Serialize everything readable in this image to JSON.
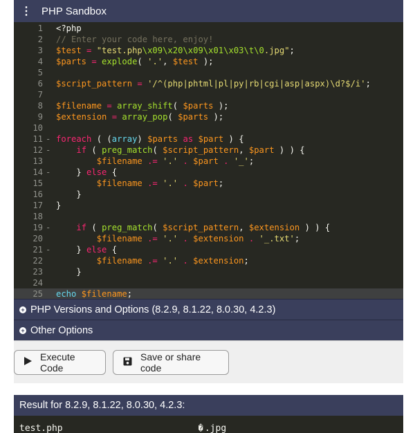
{
  "app": {
    "title": "PHP Sandbox",
    "menu_glyph": "⋮"
  },
  "editor": {
    "line_numbers": [
      "1",
      "2",
      "3",
      "4",
      "5",
      "6",
      "7",
      "8",
      "9",
      "10",
      "11",
      "12",
      "13",
      "14",
      "15",
      "16",
      "17",
      "18",
      "19",
      "20",
      "21",
      "22",
      "23",
      "24",
      "25"
    ],
    "fold_markers": [
      "",
      "",
      "",
      "",
      "",
      "",
      "",
      "",
      "",
      "",
      "-",
      "-",
      "",
      "-",
      "",
      "",
      "",
      "",
      "-",
      "",
      "-",
      "",
      "",
      "",
      ""
    ],
    "lines": [
      [
        {
          "t": "<?php",
          "c": "p"
        }
      ],
      [
        {
          "t": "// Enter your code here, enjoy!",
          "c": "c"
        }
      ],
      [
        {
          "t": "$test",
          "c": "v"
        },
        {
          "t": " = ",
          "c": "k"
        },
        {
          "t": "\"test.php",
          "c": "s"
        },
        {
          "t": "\\x09\\x20\\x09\\x01\\x03\\t\\0",
          "c": "v2"
        },
        {
          "t": ".jpg\"",
          "c": "s"
        },
        {
          "t": ";",
          "c": "p"
        }
      ],
      [
        {
          "t": "$parts",
          "c": "v"
        },
        {
          "t": " = ",
          "c": "k"
        },
        {
          "t": "explode",
          "c": "v2"
        },
        {
          "t": "( ",
          "c": "p"
        },
        {
          "t": "'.'",
          "c": "s"
        },
        {
          "t": ", ",
          "c": "p"
        },
        {
          "t": "$test",
          "c": "v"
        },
        {
          "t": " );",
          "c": "p"
        }
      ],
      [],
      [
        {
          "t": "$script_pattern",
          "c": "v"
        },
        {
          "t": " = ",
          "c": "k"
        },
        {
          "t": "'/^(php|phtml|pl|py|rb|cgi|asp|aspx)\\d?$/i'",
          "c": "s"
        },
        {
          "t": ";",
          "c": "p"
        }
      ],
      [],
      [
        {
          "t": "$filename",
          "c": "v"
        },
        {
          "t": " = ",
          "c": "k"
        },
        {
          "t": "array_shift",
          "c": "v2"
        },
        {
          "t": "( ",
          "c": "p"
        },
        {
          "t": "$parts",
          "c": "v"
        },
        {
          "t": " );",
          "c": "p"
        }
      ],
      [
        {
          "t": "$extension",
          "c": "v"
        },
        {
          "t": " = ",
          "c": "k"
        },
        {
          "t": "array_pop",
          "c": "v2"
        },
        {
          "t": "( ",
          "c": "p"
        },
        {
          "t": "$parts",
          "c": "v"
        },
        {
          "t": " );",
          "c": "p"
        }
      ],
      [],
      [
        {
          "t": "foreach",
          "c": "k"
        },
        {
          "t": " ( (",
          "c": "p"
        },
        {
          "t": "array",
          "c": "f"
        },
        {
          "t": ") ",
          "c": "p"
        },
        {
          "t": "$parts",
          "c": "v"
        },
        {
          "t": " as ",
          "c": "k"
        },
        {
          "t": "$part",
          "c": "v"
        },
        {
          "t": " ) {",
          "c": "p"
        }
      ],
      [
        {
          "t": "    ",
          "c": "p"
        },
        {
          "t": "if",
          "c": "k"
        },
        {
          "t": " ( ",
          "c": "p"
        },
        {
          "t": "preg_match",
          "c": "v2"
        },
        {
          "t": "( ",
          "c": "p"
        },
        {
          "t": "$script_pattern",
          "c": "v"
        },
        {
          "t": ", ",
          "c": "p"
        },
        {
          "t": "$part",
          "c": "v"
        },
        {
          "t": " ) ) {",
          "c": "p"
        }
      ],
      [
        {
          "t": "        ",
          "c": "p"
        },
        {
          "t": "$filename",
          "c": "v"
        },
        {
          "t": " .= ",
          "c": "k"
        },
        {
          "t": "'.'",
          "c": "s"
        },
        {
          "t": " . ",
          "c": "k"
        },
        {
          "t": "$part",
          "c": "v"
        },
        {
          "t": " . ",
          "c": "k"
        },
        {
          "t": "'_'",
          "c": "s"
        },
        {
          "t": ";",
          "c": "p"
        }
      ],
      [
        {
          "t": "    } ",
          "c": "p"
        },
        {
          "t": "else",
          "c": "k"
        },
        {
          "t": " {",
          "c": "p"
        }
      ],
      [
        {
          "t": "        ",
          "c": "p"
        },
        {
          "t": "$filename",
          "c": "v"
        },
        {
          "t": " .= ",
          "c": "k"
        },
        {
          "t": "'.'",
          "c": "s"
        },
        {
          "t": " . ",
          "c": "k"
        },
        {
          "t": "$part",
          "c": "v"
        },
        {
          "t": ";",
          "c": "p"
        }
      ],
      [
        {
          "t": "    }",
          "c": "p"
        }
      ],
      [
        {
          "t": "}",
          "c": "p"
        }
      ],
      [],
      [
        {
          "t": "    ",
          "c": "p"
        },
        {
          "t": "if",
          "c": "k"
        },
        {
          "t": " ( ",
          "c": "p"
        },
        {
          "t": "preg_match",
          "c": "v2"
        },
        {
          "t": "( ",
          "c": "p"
        },
        {
          "t": "$script_pattern",
          "c": "v"
        },
        {
          "t": ", ",
          "c": "p"
        },
        {
          "t": "$extension",
          "c": "v"
        },
        {
          "t": " ) ) {",
          "c": "p"
        }
      ],
      [
        {
          "t": "        ",
          "c": "p"
        },
        {
          "t": "$filename",
          "c": "v"
        },
        {
          "t": " .= ",
          "c": "k"
        },
        {
          "t": "'.'",
          "c": "s"
        },
        {
          "t": " . ",
          "c": "k"
        },
        {
          "t": "$extension",
          "c": "v"
        },
        {
          "t": " . ",
          "c": "k"
        },
        {
          "t": "'_.txt'",
          "c": "s"
        },
        {
          "t": ";",
          "c": "p"
        }
      ],
      [
        {
          "t": "    } ",
          "c": "p"
        },
        {
          "t": "else",
          "c": "k"
        },
        {
          "t": " {",
          "c": "p"
        }
      ],
      [
        {
          "t": "        ",
          "c": "p"
        },
        {
          "t": "$filename",
          "c": "v"
        },
        {
          "t": " .= ",
          "c": "k"
        },
        {
          "t": "'.'",
          "c": "s"
        },
        {
          "t": " . ",
          "c": "k"
        },
        {
          "t": "$extension",
          "c": "v"
        },
        {
          "t": ";",
          "c": "p"
        }
      ],
      [
        {
          "t": "    }",
          "c": "p"
        }
      ],
      [],
      [
        {
          "t": "echo",
          "c": "f"
        },
        {
          "t": " ",
          "c": "p"
        },
        {
          "t": "$filename",
          "c": "v"
        },
        {
          "t": ";",
          "c": "p"
        }
      ]
    ],
    "active_line": 25
  },
  "panels": {
    "versions_label": "PHP Versions and Options (8.2.9, 8.1.22, 8.0.30, 4.2.3)",
    "other_label": "Other Options",
    "expand_glyph": "+"
  },
  "toolbar": {
    "execute_label": "Execute Code",
    "execute_icon": "play-icon",
    "share_label": "Save or share code",
    "share_icon": "save-icon"
  },
  "result": {
    "heading": "Result for 8.2.9, 8.1.22, 8.0.30, 4.2.3:",
    "output_left": "test.php",
    "output_right": ".jpg",
    "invalid_glyph": "\u0000"
  },
  "colors": {
    "header_bg": "#3a3f5c",
    "editor_bg": "#272822",
    "keyword": "#f92672",
    "variable": "#fd971f",
    "function": "#a6e22e",
    "string": "#e6db74",
    "comment": "#75715e"
  }
}
